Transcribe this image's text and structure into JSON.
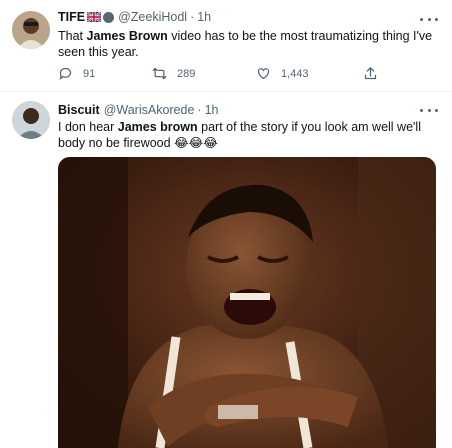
{
  "tweets": [
    {
      "name": "TIFE",
      "handle": "@ZeekiHodl",
      "time": "1h",
      "text_before": "That ",
      "text_bold": "James Brown",
      "text_after": " video has to be the most traumatizing thing I've seen this year.",
      "replies": "91",
      "retweets": "289",
      "likes": "1,443"
    },
    {
      "name": "Biscuit",
      "handle": "@WarisAkorede",
      "time": "1h",
      "text_before": "I don hear ",
      "text_bold": "James brown",
      "text_after": " part of the story if you look am well we'll body no be firewood 😂😂😂"
    }
  ],
  "icons": {
    "reply": "reply-icon",
    "retweet": "retweet-icon",
    "like": "heart-icon",
    "share": "share-icon",
    "more": "more-icon"
  },
  "colors": {
    "text": "#0f1419",
    "secondary": "#536471",
    "divider": "#eff3f4"
  }
}
